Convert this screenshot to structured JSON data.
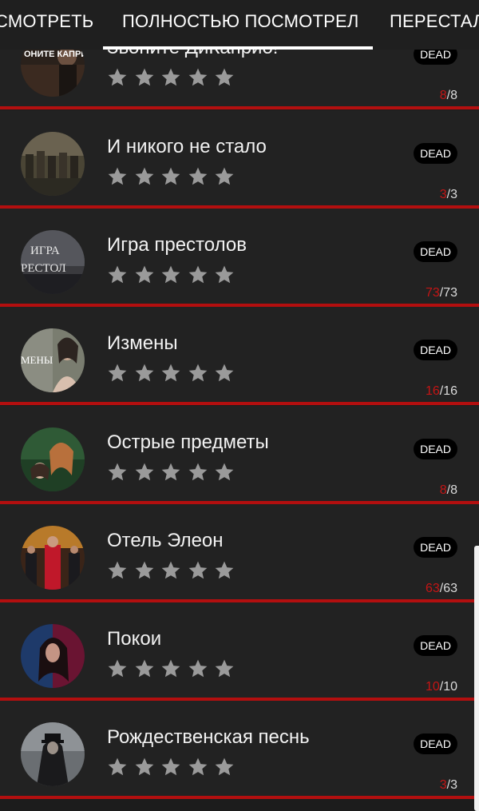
{
  "tabs": [
    {
      "label": "СМОТРЕТЬ",
      "active": false
    },
    {
      "label": "ПОЛНОСТЬЮ ПОСМОТРЕЛ",
      "active": true
    },
    {
      "label": "ПЕРЕСТАЛ",
      "active": false
    }
  ],
  "colors": {
    "accent_red": "#b30f0f",
    "watched_red": "#c41515",
    "row_bg": "#222222",
    "star_gray": "#9a9a9a",
    "badge_bg": "#000000"
  },
  "rating_icon": "star-icon",
  "rating_max": 5,
  "shows": [
    {
      "title": "Звоните ДиКаприо!",
      "status": "DEAD",
      "watched": "8",
      "total": "/8",
      "rating": 0
    },
    {
      "title": "И никого не стало",
      "status": "DEAD",
      "watched": "3",
      "total": "/3",
      "rating": 0
    },
    {
      "title": "Игра престолов",
      "status": "DEAD",
      "watched": "73",
      "total": "/73",
      "rating": 0
    },
    {
      "title": "Измены",
      "status": "DEAD",
      "watched": "16",
      "total": "/16",
      "rating": 0
    },
    {
      "title": "Острые предметы",
      "status": "DEAD",
      "watched": "8",
      "total": "/8",
      "rating": 0
    },
    {
      "title": "Отель Элеон",
      "status": "DEAD",
      "watched": "63",
      "total": "/63",
      "rating": 0
    },
    {
      "title": "Покои",
      "status": "DEAD",
      "watched": "10",
      "total": "/10",
      "rating": 0
    },
    {
      "title": "Рождественская песнь",
      "status": "DEAD",
      "watched": "3",
      "total": "/3",
      "rating": 0
    }
  ],
  "poster_texts": {
    "dicaprio": "ОНИТЕ КАПРИО!",
    "got_line1": "ИГРА",
    "got_line2": "РЕСТОЛ",
    "izmeny": "МЕНЫ"
  }
}
